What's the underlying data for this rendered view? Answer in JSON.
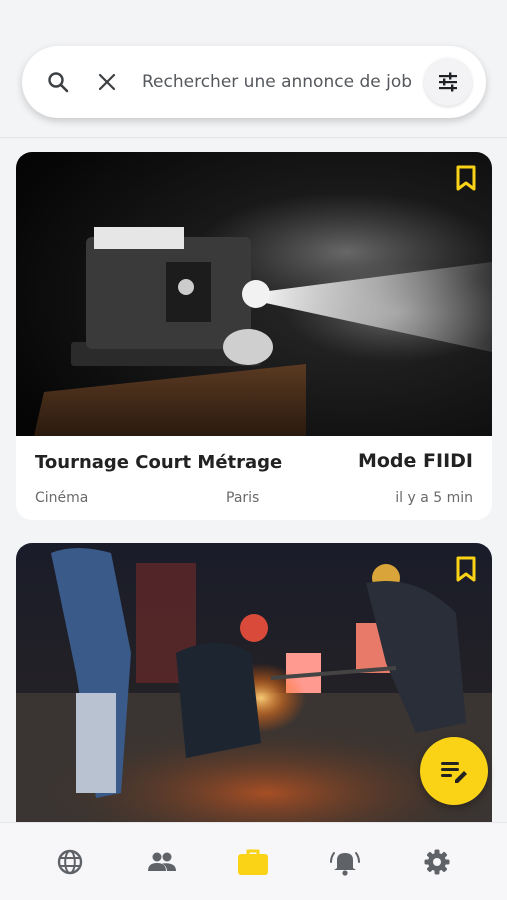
{
  "search": {
    "placeholder": "Rechercher une annonce de job"
  },
  "colors": {
    "accent": "#FAD316",
    "nav_icon": "#5F6368",
    "nav_active": "#FAD316"
  },
  "jobs": [
    {
      "title": "Tournage Court Métrage",
      "company": "Mode FIIDI",
      "category": "Cinéma",
      "city": "Paris",
      "time": "il y a 5 min",
      "image": "film-projector-photo",
      "bookmark_icon": "bookmark-icon"
    },
    {
      "image": "foundry-workers-photo",
      "bookmark_icon": "bookmark-icon"
    }
  ],
  "nav": {
    "items": [
      {
        "icon": "globe-icon",
        "active": false
      },
      {
        "icon": "people-icon",
        "active": false
      },
      {
        "icon": "briefcase-icon",
        "active": true
      },
      {
        "icon": "notification-bell-icon",
        "active": false
      },
      {
        "icon": "settings-gear-icon",
        "active": false
      }
    ]
  },
  "fab": {
    "icon": "edit-note-icon"
  }
}
